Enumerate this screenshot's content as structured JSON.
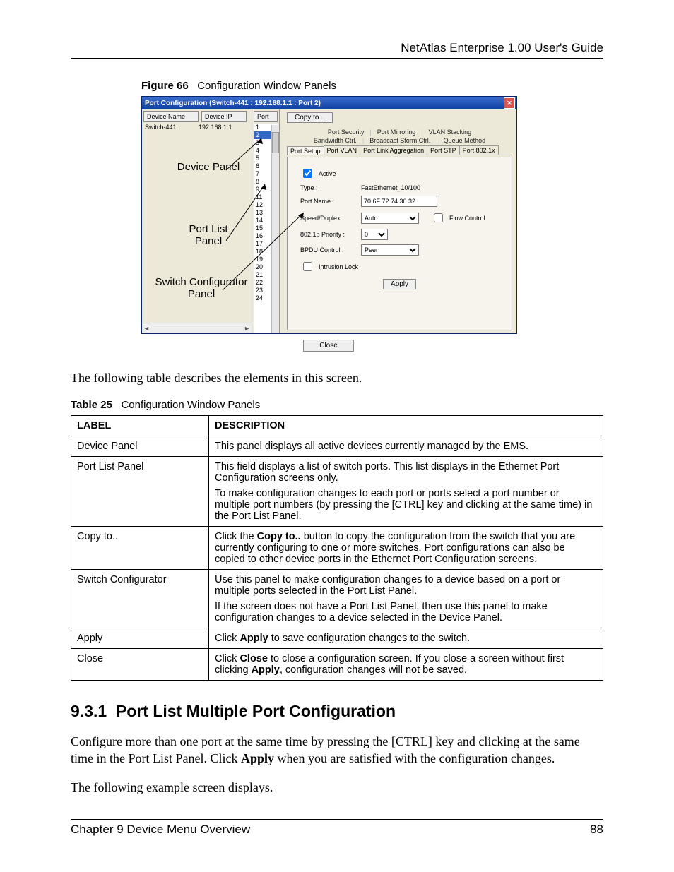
{
  "header": {
    "running": "NetAtlas Enterprise 1.00 User's Guide"
  },
  "figure": {
    "caption_label": "Figure 66",
    "caption_text": "Configuration Window Panels",
    "titlebar": "Port Configuration (Switch-441 : 192.168.1.1 : Port 2)",
    "device_head_name": "Device Name",
    "device_head_ip": "Device IP",
    "device_row_name": "Switch-441",
    "device_row_ip": "192.168.1.1",
    "port_head": "Port",
    "ports": [
      "1",
      "2",
      "3",
      "4",
      "5",
      "6",
      "7",
      "8",
      "9",
      "",
      "11",
      "12",
      "13",
      "14",
      "15",
      "16",
      "17",
      "18",
      "19",
      "20",
      "21",
      "22",
      "23",
      "24"
    ],
    "copy_to": "Copy to ..",
    "tabs_top": [
      "Port Security",
      "Port Mirroring",
      "VLAN Stacking",
      "Bandwidth Ctrl.",
      "Broadcast Storm Ctrl.",
      "Queue Method"
    ],
    "tabs_sub": [
      "Port Setup",
      "Port VLAN",
      "Port Link Aggregation",
      "Port STP",
      "Port 802.1x"
    ],
    "form": {
      "active": "Active",
      "type_lbl": "Type :",
      "type_val": "FastEthernet_10/100",
      "name_lbl": "Port Name :",
      "name_val": "70 6F 72 74 30 32",
      "speed_lbl": "Speed/Duplex :",
      "speed_val": "Auto",
      "flow_ctrl": "Flow Control",
      "prio_lbl": "802.1p Priority :",
      "prio_val": "0",
      "bpdu_lbl": "BPDU Control :",
      "bpdu_val": "Peer",
      "intrusion": "Intrusion Lock",
      "apply": "Apply"
    },
    "close": "Close",
    "anno_device": "Device Panel",
    "anno_portlist1": "Port List",
    "anno_portlist2": "Panel",
    "anno_switch1": "Switch Configurator",
    "anno_switch2": "Panel"
  },
  "para1": "The following table describes the elements in this screen.",
  "table": {
    "caption_label": "Table 25",
    "caption_text": "Configuration Window Panels",
    "head_label": "LABEL",
    "head_desc": "DESCRIPTION",
    "rows": [
      {
        "label": "Device Panel",
        "desc": [
          "This panel displays all active devices currently managed by the EMS."
        ]
      },
      {
        "label": "Port List Panel",
        "desc": [
          "This field displays a list of switch ports. This list displays in the Ethernet Port Configuration screens only.",
          "To make configuration changes to each port or ports select a port number or multiple port numbers (by pressing the [CTRL] key and clicking at the same time) in the Port List Panel."
        ]
      },
      {
        "label": "Copy to..",
        "desc": [
          "Click the <b>Copy to..</b> button to copy the configuration from the switch that you are currently configuring to one or more switches. Port configurations can also be copied to other device ports in the Ethernet Port Configuration screens."
        ]
      },
      {
        "label": "Switch Configurator",
        "desc": [
          "Use this panel to make configuration changes to a device based on a port or multiple ports selected in the Port List Panel.",
          "If the screen does not have a Port List Panel, then use this panel to make configuration changes to a device selected in the Device Panel."
        ]
      },
      {
        "label": "Apply",
        "desc": [
          "Click <b>Apply</b> to save configuration changes to the switch."
        ]
      },
      {
        "label": "Close",
        "desc": [
          "Click <b>Close</b> to close a configuration screen. If you close a screen without first clicking <b>Apply</b>, configuration changes will not be saved."
        ]
      }
    ]
  },
  "section": {
    "num": "9.3.1",
    "title": "Port List Multiple Port Configuration"
  },
  "para2_a": "Configure more than one port at the same time by pressing the [CTRL] key and clicking at the same time in the Port List Panel. Click ",
  "para2_b": "Apply",
  "para2_c": " when you are satisfied with the configuration changes.",
  "para3": "The following example screen displays.",
  "footer": {
    "chapter": "Chapter 9 Device Menu Overview",
    "page": "88"
  }
}
